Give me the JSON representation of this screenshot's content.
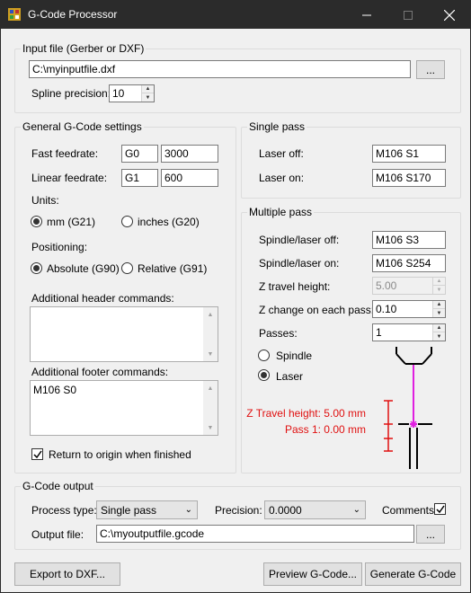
{
  "window": {
    "title": "G-Code Processor"
  },
  "input": {
    "group_label": "Input file (Gerber or DXF)",
    "file_value": "C:\\myinputfile.dxf",
    "browse_label": "...",
    "spline_label": "Spline precision:",
    "spline_value": "10"
  },
  "general": {
    "group_label": "General G-Code settings",
    "fast_label": "Fast feedrate:",
    "fast_code": "G0",
    "fast_value": "3000",
    "linear_label": "Linear feedrate:",
    "linear_code": "G1",
    "linear_value": "600",
    "units_label": "Units:",
    "units_mm": "mm (G21)",
    "units_inches": "inches (G20)",
    "positioning_label": "Positioning:",
    "pos_absolute": "Absolute (G90)",
    "pos_relative": "Relative (G91)",
    "header_label": "Additional header commands:",
    "header_value": "",
    "footer_label": "Additional footer commands:",
    "footer_value": "M106 S0",
    "return_label": "Return to origin when finished"
  },
  "single": {
    "group_label": "Single pass",
    "laser_off_label": "Laser off:",
    "laser_off_value": "M106 S1",
    "laser_on_label": "Laser on:",
    "laser_on_value": "M106 S170"
  },
  "multi": {
    "group_label": "Multiple pass",
    "spindle_off_label": "Spindle/laser off:",
    "spindle_off_value": "M106 S3",
    "spindle_on_label": "Spindle/laser on:",
    "spindle_on_value": "M106 S254",
    "z_travel_label": "Z travel height:",
    "z_travel_value": "5.00",
    "z_change_label": "Z change on each pass:",
    "z_change_value": "0.10",
    "passes_label": "Passes:",
    "passes_value": "1",
    "mode_spindle": "Spindle",
    "mode_laser": "Laser",
    "diagram_travel": "Z Travel height: 5.00 mm",
    "diagram_pass": "Pass 1: 0.00 mm",
    "accent_color": "#e01010",
    "beam_color": "#e020e0"
  },
  "output": {
    "group_label": "G-Code output",
    "process_label": "Process type:",
    "process_value": "Single pass",
    "precision_label": "Precision:",
    "precision_value": "0.0000",
    "comments_label": "Comments",
    "file_label": "Output file:",
    "file_value": "C:\\myoutputfile.gcode",
    "browse_label": "..."
  },
  "buttons": {
    "export": "Export to DXF...",
    "preview": "Preview G-Code...",
    "generate": "Generate G-Code"
  }
}
